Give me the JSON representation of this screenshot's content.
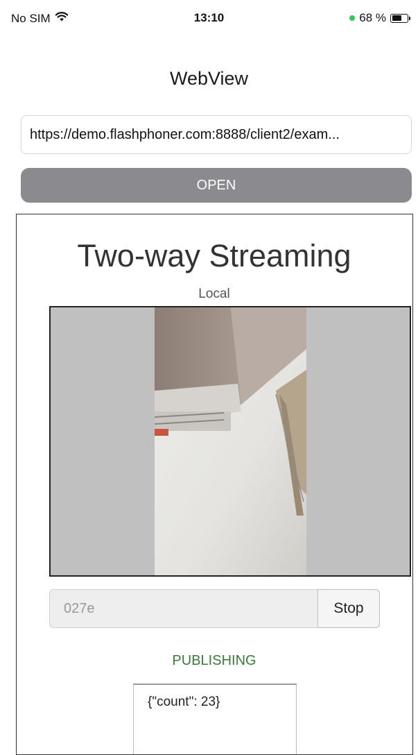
{
  "status_bar": {
    "carrier": "No SIM",
    "time": "13:10",
    "battery_text": "68 %",
    "battery_level": 0.68,
    "wifi_icon": "wifi-icon",
    "battery_icon": "battery-icon"
  },
  "nav": {
    "title": "WebView"
  },
  "url_field": {
    "value": "https://demo.flashphoner.com:8888/client2/exam..."
  },
  "open_button": {
    "label": "OPEN"
  },
  "web_page": {
    "title": "Two-way Streaming",
    "local_label": "Local",
    "stream_name": "027e",
    "stop_label": "Stop",
    "status": "PUBLISHING",
    "info_text": "{\"count\": 23}"
  },
  "colors": {
    "open_button_bg": "#8a8a8f",
    "status_green": "#3d7a3a",
    "video_bg": "#c0c0c0"
  }
}
